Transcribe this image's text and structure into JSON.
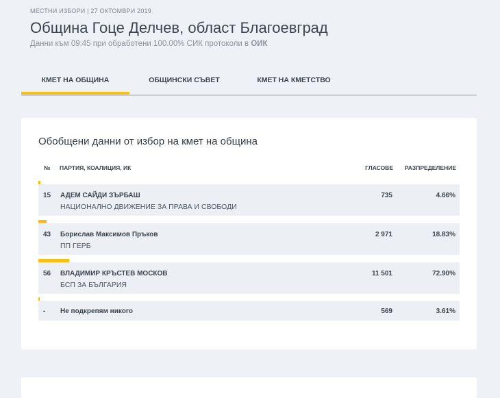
{
  "header": {
    "pretitle": "МЕСТНИ ИЗБОРИ | 27 ОКТОМВРИ 2019",
    "title": "Община Гоце Делчев, област Благоевград",
    "subtitle_prefix": "Данни към 09:45 при обработени 100.00% СИК протоколи в ",
    "subtitle_bold": "ОИК"
  },
  "tabs": [
    {
      "label": "КМЕТ НА ОБЩИНА",
      "active": true
    },
    {
      "label": "ОБЩИНСКИ СЪВЕТ",
      "active": false
    },
    {
      "label": "КМЕТ НА КМЕТСТВО",
      "active": false
    }
  ],
  "results": {
    "title": "Обобщени данни от избор на кмет на община",
    "columns": {
      "no": "№",
      "party": "ПАРТИЯ, КОАЛИЦИЯ, ИК",
      "votes": "ГЛАСОВЕ",
      "share": "РАЗПРЕДЕЛЕНИЕ"
    },
    "rows": [
      {
        "no": "15",
        "name": "АДЕМ САЙДИ ЗЪРБАШ",
        "party": "НАЦИОНАЛНО ДВИЖЕНИЕ ЗА ПРАВА И СВОБОДИ",
        "votes": "735",
        "share": "4.66%",
        "share_value": 4.66
      },
      {
        "no": "43",
        "name": "Борислав Максимов Пръков",
        "party": "ПП ГЕРБ",
        "votes": "2 971",
        "share": "18.83%",
        "share_value": 18.83
      },
      {
        "no": "56",
        "name": "ВЛАДИМИР КРЪСТЕВ МОСКОВ",
        "party": "БСП ЗА БЪЛГАРИЯ",
        "votes": "11 501",
        "share": "72.90%",
        "share_value": 72.9
      },
      {
        "no": "-",
        "name": "Не подкрепям никого",
        "party": "",
        "votes": "569",
        "share": "3.61%",
        "share_value": 3.61
      }
    ]
  },
  "colors": {
    "accent": "#f6be17",
    "background": "#eef1f5",
    "row_background": "#eceff3"
  }
}
